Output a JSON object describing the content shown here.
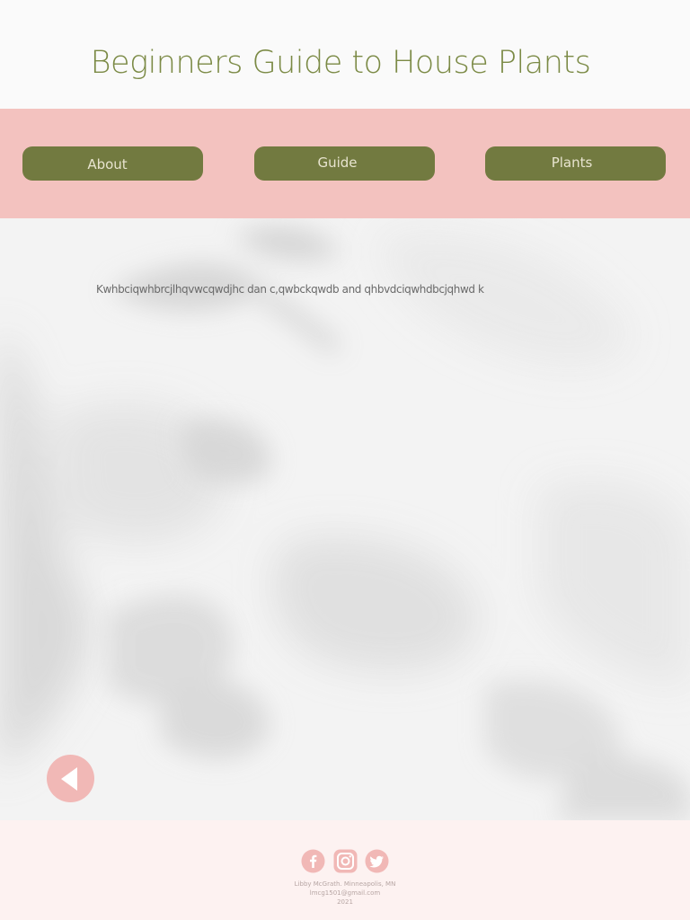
{
  "header": {
    "title": "Beginners Guide to House Plants"
  },
  "nav": {
    "about_label": "About",
    "guide_label": "Guide",
    "plants_label": "Plants"
  },
  "main": {
    "body_text": "Kwhbciqwhbrcjlhqvwcqwdjhc dan c,qwbckqwdb and qhbvdciqwhdbcjqhwd k"
  },
  "back_button": {
    "icon": "back-arrow-icon"
  },
  "footer": {
    "social_icons": [
      "facebook-icon",
      "instagram-icon",
      "twitter-icon"
    ],
    "line1": "Libby McGrath. Minneapolis, MN",
    "line2": "lmcg1501@gmail.com",
    "line3": "2021"
  },
  "colors": {
    "title_green": "#7b8a45",
    "nav_band_pink": "#f3c2bf",
    "button_olive": "#727a40",
    "footer_bg": "#fdf2f1",
    "accent_pink": "#f1b8b6"
  }
}
